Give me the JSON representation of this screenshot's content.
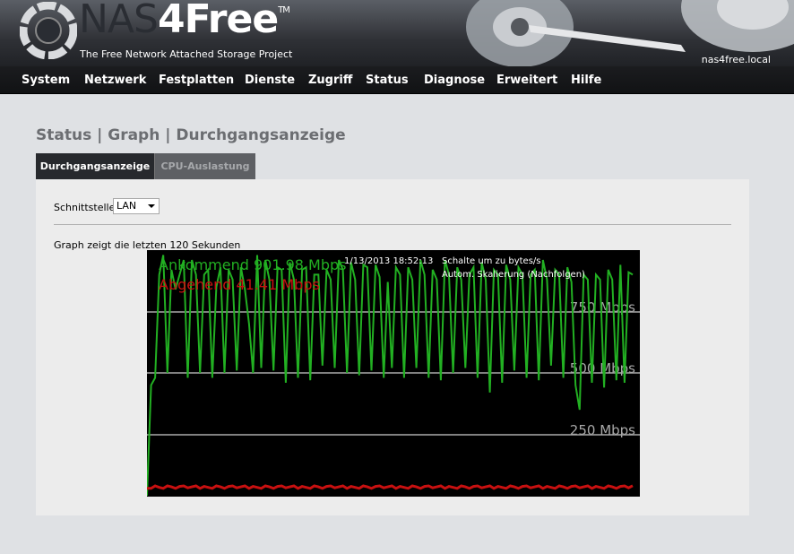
{
  "header": {
    "brand_prefix": "NAS",
    "brand_suffix": "4Free",
    "trademark": "TM",
    "tagline": "The Free Network Attached Storage Project",
    "hostname": "nas4free.local"
  },
  "nav": {
    "items": [
      "System",
      "Netzwerk",
      "Festplatten",
      "Dienste",
      "Zugriff",
      "Status",
      "Diagnose",
      "Erweitert",
      "Hilfe"
    ]
  },
  "page": {
    "title": "Status | Graph | Durchgangsanzeige",
    "tabs": [
      {
        "label": "Durchgangsanzeige",
        "active": true
      },
      {
        "label": "CPU-Auslastung",
        "active": false
      }
    ],
    "interface_label": "Schnittstelle:",
    "interface_value": "LAN",
    "graph_caption": "Graph zeigt die letzten 120 Sekunden"
  },
  "graph": {
    "timestamp": "1/13/2013 18:52:13",
    "toggle_units": "Schalte um zu bytes/s",
    "autoscale": "Autom. Skalierung (Nachfolgen)",
    "incoming_label": "Ankommend 901.98 Mbps",
    "outgoing_label": "Abgehend 41.41 Mbps",
    "colors": {
      "incoming": "#22b022",
      "outgoing": "#c81010",
      "grid": "#808080",
      "background": "#000000"
    }
  },
  "chart_data": {
    "type": "line",
    "ylim": [
      0,
      1000
    ],
    "y_ticks": [
      250,
      500,
      750
    ],
    "y_tick_labels": [
      "250 Mbps",
      "500 Mbps",
      "750 Mbps"
    ],
    "series": [
      {
        "name": "Ankommend",
        "values": [
          0,
          450,
          480,
          900,
          980,
          500,
          920,
          840,
          900,
          960,
          480,
          960,
          900,
          500,
          900,
          920,
          480,
          850,
          930,
          500,
          920,
          880,
          510,
          930,
          840,
          700,
          500,
          980,
          520,
          960,
          880,
          510,
          930,
          920,
          460,
          950,
          880,
          480,
          920,
          930,
          470,
          900,
          900,
          530,
          920,
          880,
          520,
          960,
          920,
          500,
          950,
          880,
          490,
          940,
          930,
          510,
          940,
          890,
          480,
          870,
          520,
          930,
          900,
          480,
          930,
          880,
          520,
          960,
          900,
          480,
          920,
          880,
          470,
          960,
          900,
          500,
          930,
          880,
          520,
          900,
          930,
          480,
          950,
          880,
          420,
          920,
          900,
          460,
          940,
          880,
          510,
          930,
          900,
          480,
          900,
          920,
          470,
          960,
          880,
          530,
          920,
          900,
          480,
          930,
          870,
          450,
          350,
          900,
          880,
          460,
          900,
          880,
          440,
          920,
          880,
          470,
          940,
          460,
          910,
          900
        ]
      },
      {
        "name": "Abgehend",
        "values": [
          30,
          30,
          40,
          34,
          30,
          40,
          36,
          30,
          38,
          40,
          32,
          36,
          40,
          30,
          38,
          34,
          30,
          40,
          36,
          30,
          38,
          40,
          32,
          36,
          40,
          30,
          38,
          34,
          30,
          40,
          36,
          30,
          38,
          40,
          32,
          36,
          40,
          30,
          38,
          34,
          30,
          40,
          36,
          30,
          38,
          40,
          32,
          36,
          40,
          30,
          38,
          34,
          30,
          40,
          36,
          30,
          38,
          40,
          32,
          36,
          40,
          30,
          38,
          34,
          30,
          40,
          36,
          30,
          38,
          40,
          32,
          36,
          40,
          30,
          38,
          34,
          30,
          40,
          36,
          30,
          38,
          40,
          32,
          36,
          40,
          30,
          38,
          34,
          30,
          40,
          36,
          30,
          38,
          40,
          32,
          36,
          40,
          30,
          38,
          34,
          30,
          40,
          36,
          30,
          38,
          40,
          32,
          36,
          40,
          30,
          38,
          34,
          30,
          40,
          36,
          30,
          38,
          40,
          32,
          41
        ]
      }
    ]
  }
}
